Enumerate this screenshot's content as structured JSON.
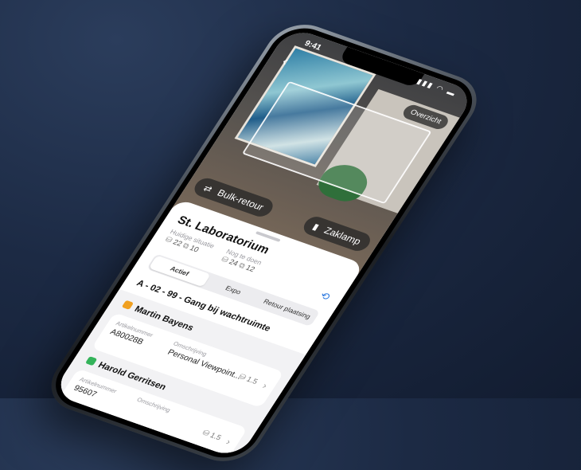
{
  "status": {
    "time": "9:41",
    "icons": "▮▮▮ ◠ ▬"
  },
  "camera": {
    "overview_label": "Overzicht"
  },
  "actions": {
    "bulk_label": "Bulk-retour",
    "flashlight_label": "Zaklamp"
  },
  "sheet": {
    "title": "St. Laboratorium",
    "current": {
      "label": "Huidige situatie",
      "a": "22",
      "b": "10"
    },
    "todo": {
      "label": "Nog te doen",
      "a": "24",
      "b": "12"
    },
    "tabs": [
      "Actief",
      "Expo",
      "Retour plaatsing"
    ],
    "active_tab": 0,
    "location": "A - 02 - 99 - Gang bij wachtruimte"
  },
  "people": [
    {
      "name": "Martin Bayens",
      "tag_color": "#f0a020",
      "item": {
        "article_label": "Artikelnummer",
        "article": "A80028B",
        "desc_label": "Omschrijving",
        "desc": "Personal Viewpoint...",
        "qty": "1.5"
      }
    },
    {
      "name": "Harold Gerritsen",
      "tag_color": "#34b35a",
      "item": {
        "article_label": "Artikelnummer",
        "article": "95607",
        "desc_label": "Omschrijving",
        "desc": "",
        "qty": "1.5"
      }
    }
  ],
  "colors": {
    "accent": "#2f7be0"
  }
}
